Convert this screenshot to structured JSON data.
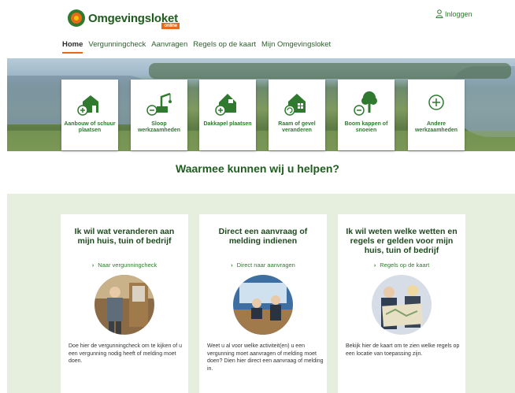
{
  "brand": {
    "name": "Omgevingsloket",
    "sub": "online"
  },
  "header": {
    "login_label": "Inloggen"
  },
  "nav": {
    "items": [
      "Home",
      "Vergunningcheck",
      "Aanvragen",
      "Regels op de kaart",
      "Mijn Omgevingsloket"
    ],
    "active": "Home"
  },
  "tiles": [
    {
      "label": "Aanbouw of schuur plaatsen",
      "icon": "house-plus-icon"
    },
    {
      "label": "Sloop werkzaamheden",
      "icon": "crane-icon"
    },
    {
      "label": "Dakkapel plaatsen",
      "icon": "dormer-house-icon"
    },
    {
      "label": "Raam of gevel veranderen",
      "icon": "window-house-icon"
    },
    {
      "label": "Boom kappen of snoeien",
      "icon": "tree-minus-icon"
    },
    {
      "label": "Andere werkzaamheden",
      "icon": "plus-circle-icon"
    }
  ],
  "help": {
    "title": "Waarmee kunnen wij u helpen?"
  },
  "cards": [
    {
      "title": "Ik wil wat veranderen aan mijn huis, tuin of bedrijf",
      "link": "Naar vergunningcheck",
      "text": "Doe hier de vergunningcheck om te kijken of u een vergunning nodig heeft of melding moet doen."
    },
    {
      "title": "Direct een aanvraag of melding indienen",
      "link": "Direct naar aanvragen",
      "text": "Weet u al voor welke activiteit(en) u een vergunning moet aanvragen of melding moet doen? Dien hier direct een aanvraag of melding in."
    },
    {
      "title": "Ik wil weten welke wetten en regels er gelden voor mijn huis, tuin of bedrijf",
      "link": "Regels op de kaart",
      "text": "Bekijk hier de kaart om te zien welke regels op een locatie van toepassing zijn."
    }
  ],
  "colors": {
    "brand_green": "#2f7a2f",
    "dark_green": "#1f5d1f",
    "accent_orange": "#e36b1a",
    "band_bg": "#e6efde"
  }
}
